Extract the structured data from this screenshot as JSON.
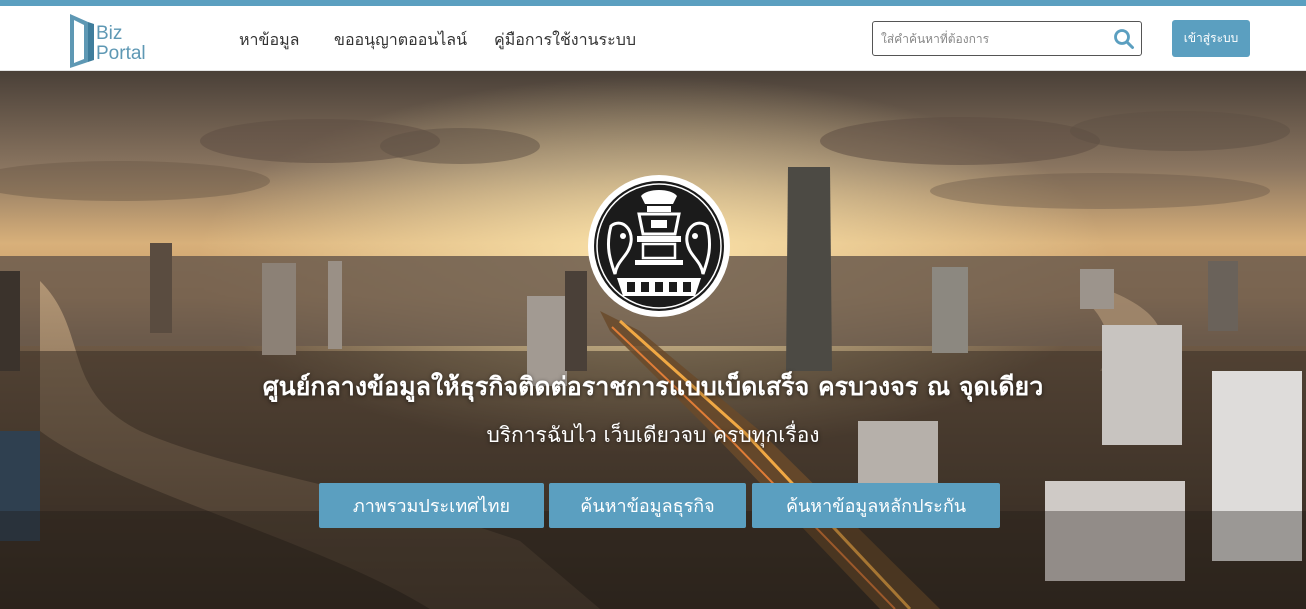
{
  "brand": {
    "logo_line1": "Biz",
    "logo_line2": "Portal",
    "accent_color": "#5b9fc0"
  },
  "nav": {
    "items": [
      {
        "label": "หาข้อมูล"
      },
      {
        "label": "ขออนุญาตออนไลน์"
      },
      {
        "label": "คู่มือการใช้งานระบบ"
      }
    ]
  },
  "search": {
    "placeholder": "ใส่คำค้นหาที่ต้องการ",
    "value": "",
    "icon": "search-icon"
  },
  "login": {
    "label": "เข้าสู่ระบบ"
  },
  "hero": {
    "seal_icon": "government-seal-icon",
    "headline": "ศูนย์กลางข้อมูลให้ธุรกิจติดต่อราชการแบบเบ็ดเสร็จ ครบวงจร ณ จุดเดียว",
    "subline": "บริการฉับไว เว็บเดียวจบ ครบทุกเรื่อง",
    "buttons": [
      {
        "label": "ภาพรวมประเทศไทย"
      },
      {
        "label": "ค้นหาข้อมูลธุรกิจ"
      },
      {
        "label": "ค้นหาข้อมูลหลักประกัน"
      }
    ]
  }
}
